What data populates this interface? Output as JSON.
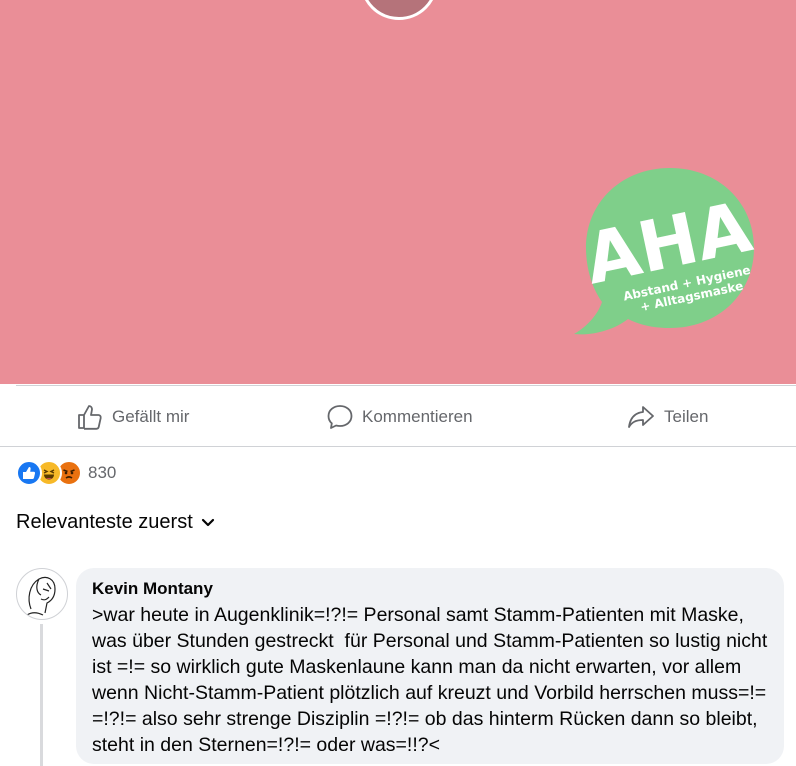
{
  "post": {
    "image": {
      "background_color": "#ea8e97",
      "logo": {
        "main_text": "AHA",
        "sub_line_1": "Abstand + Hygiene",
        "sub_line_2": "+ Alltagsmaske",
        "color": "#7fcf8a"
      }
    },
    "actions": [
      {
        "label": "Gefällt mir",
        "icon": "thumbs-up-icon"
      },
      {
        "label": "Kommentieren",
        "icon": "comment-icon"
      },
      {
        "label": "Teilen",
        "icon": "share-icon"
      }
    ],
    "reactions": {
      "types": [
        "like",
        "haha",
        "angry"
      ],
      "count": "830"
    }
  },
  "comments": {
    "sort_label": "Relevanteste zuerst",
    "items": [
      {
        "author": "Kevin Montany",
        "text": ">war heute in Augenklinik=!?!= Personal samt Stamm-Patienten mit Maske, was über Stunden gestreckt  für Personal und Stamm-Patienten so lustig nicht ist =!= so wirklich gute Maskenlaune kann man da nicht erwarten, vor allem wenn Nicht-Stamm-Patient plötzlich auf kreuzt und Vorbild herrschen muss=!=  =!?!= also sehr strenge Disziplin =!?!= ob das hinterm Rücken dann so bleibt, steht in den Sternen=!?!= oder was=!!?<"
      }
    ]
  },
  "colors": {
    "accent_blue": "#1877f2",
    "secondary_text": "#65676b",
    "bubble_bg": "#f0f2f5"
  }
}
